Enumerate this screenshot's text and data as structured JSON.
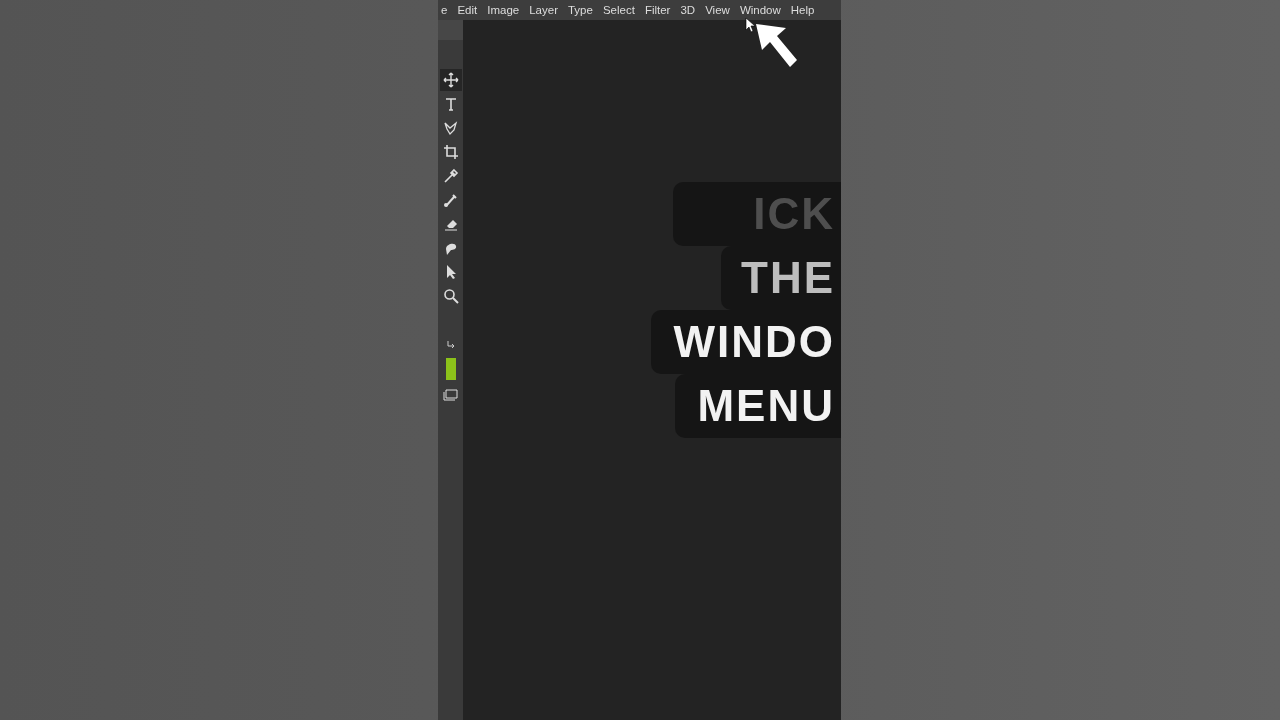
{
  "menu_bar": {
    "items": [
      "e",
      "Edit",
      "Image",
      "Layer",
      "Type",
      "Select",
      "Filter",
      "3D",
      "View",
      "Window",
      "Help"
    ]
  },
  "caption": {
    "lines": [
      {
        "text": "ICK",
        "kind": "dim"
      },
      {
        "text": "THE",
        "kind": "mid"
      },
      {
        "text": "WINDO",
        "kind": "bright"
      },
      {
        "text": "MENU",
        "kind": "bright"
      }
    ]
  }
}
